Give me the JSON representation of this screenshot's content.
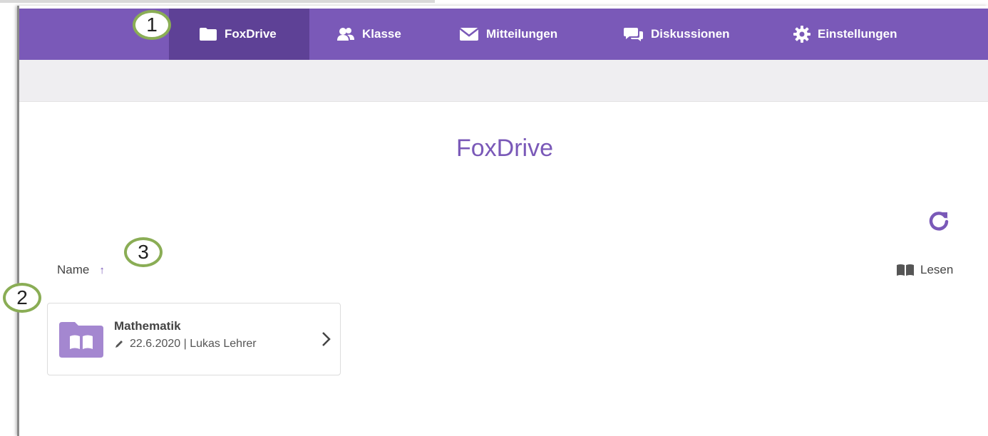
{
  "nav": {
    "items": [
      {
        "label": "FoxDrive",
        "icon": "folder-icon"
      },
      {
        "label": "Klasse",
        "icon": "users-icon"
      },
      {
        "label": "Mitteilungen",
        "icon": "envelope-icon"
      },
      {
        "label": "Diskussionen",
        "icon": "comments-icon"
      },
      {
        "label": "Einstellungen",
        "icon": "gear-icon"
      }
    ],
    "active": "FoxDrive"
  },
  "main": {
    "title": "FoxDrive",
    "sort_label": "Name",
    "sort_arrow": "↑",
    "permission_label": "Lesen",
    "refresh_icon": "refresh-icon"
  },
  "folders": [
    {
      "name": "Mathematik",
      "date": "22.6.2020",
      "author": "Lukas Lehrer",
      "meta": "22.6.2020 | Lukas Lehrer",
      "icon": "book-folder-icon"
    }
  ],
  "annotations": [
    "1",
    "2",
    "3"
  ],
  "colors": {
    "brand": "#7a59b8",
    "brand_dark": "#5e4196",
    "marker_border": "#8aad55",
    "folder_icon": "#a487d0"
  }
}
